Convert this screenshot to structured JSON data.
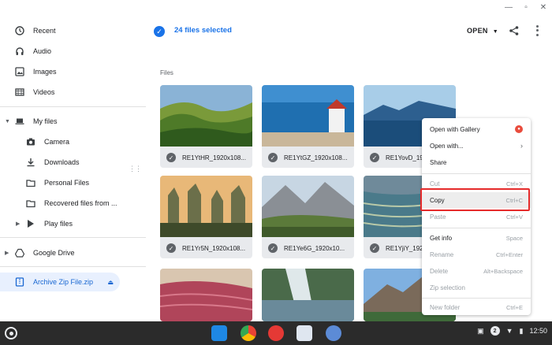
{
  "sidebar": {
    "recent": "Recent",
    "audio": "Audio",
    "images": "Images",
    "videos": "Videos",
    "my_files": "My files",
    "camera": "Camera",
    "downloads": "Downloads",
    "personal_files": "Personal Files",
    "recovered_files": "Recovered files from ...",
    "play_files": "Play files",
    "google_drive": "Google Drive",
    "archive": "Archive Zip File.zip"
  },
  "toolbar": {
    "selection_text": "24 files selected",
    "open_label": "OPEN"
  },
  "section_label": "Files",
  "files": [
    {
      "name": "RE1YtHR_1920x108..."
    },
    {
      "name": "RE1YtGZ_1920x108..."
    },
    {
      "name": "RE1YovD_1920x108..."
    },
    {
      "name": "RE1Yr5N_1920x108..."
    },
    {
      "name": "RE1Ye6G_1920x10..."
    },
    {
      "name": "RE1YjiY_1920x108..."
    }
  ],
  "context_menu": {
    "open_with_gallery": "Open with Gallery",
    "open_with": "Open with...",
    "share": "Share",
    "cut": "Cut",
    "cut_sc": "Ctrl+X",
    "copy": "Copy",
    "copy_sc": "Ctrl+C",
    "paste": "Paste",
    "paste_sc": "Ctrl+V",
    "get_info": "Get info",
    "get_info_sc": "Space",
    "rename": "Rename",
    "rename_sc": "Ctrl+Enter",
    "delete": "Delete",
    "delete_sc": "Alt+Backspace",
    "zip_selection": "Zip selection",
    "new_folder": "New folder",
    "new_folder_sc": "Ctrl+E"
  },
  "shelf": {
    "clock": "12:50",
    "notification_count": "2"
  },
  "colors": {
    "accent": "#1a73e8",
    "highlight_box": "#e52b2b",
    "shelf_bg": "#2b2b2b"
  }
}
